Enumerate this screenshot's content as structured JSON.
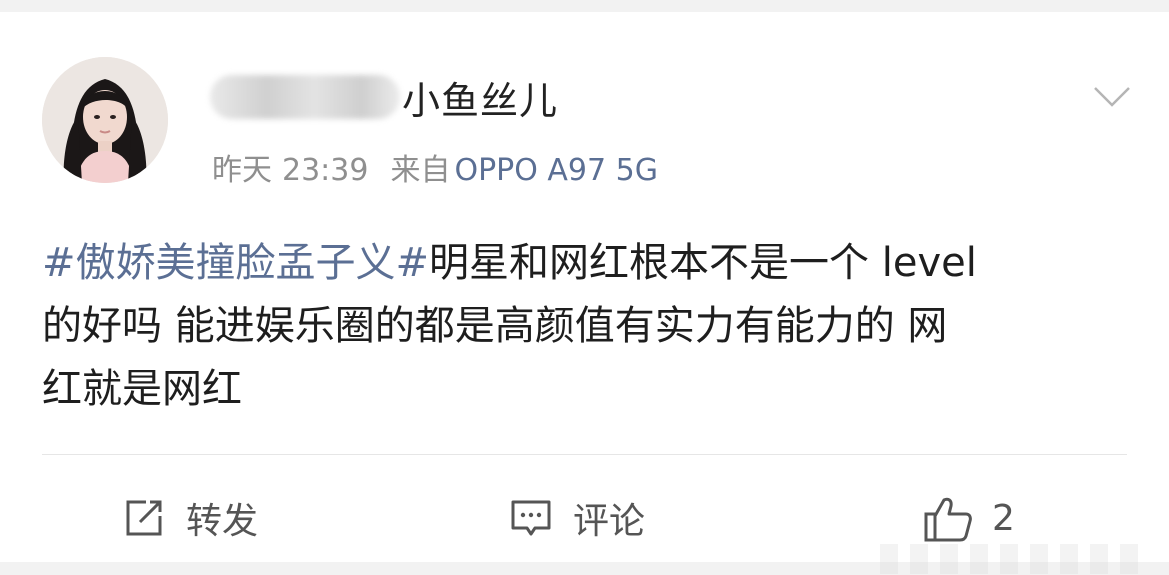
{
  "post": {
    "author": {
      "name_visible": "小鱼丝儿",
      "avatar_icon": "avatar-icon"
    },
    "meta": {
      "day": "昨天",
      "time": "23:39",
      "from_label": "来自",
      "device": "OPPO A97 5G"
    },
    "content": {
      "topic": "#傲娇美撞脸孟子义#",
      "text": "明星和网红根本不是一个 level\n的好吗 能进娱乐圈的都是高颜值有实力有能力的 网\n红就是网红"
    },
    "actions": {
      "repost_label": "转发",
      "comment_label": "评论",
      "like_count": "2"
    }
  },
  "colors": {
    "topic_link": "#5b6f94",
    "text": "#1e1e1e",
    "meta": "#8f8f8f",
    "page_bg": "#f2f2f2"
  }
}
